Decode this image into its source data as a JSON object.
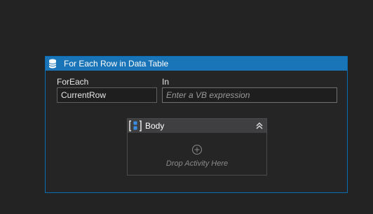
{
  "activity": {
    "title": "For Each Row in Data Table",
    "icon": "data-table-icon"
  },
  "fields": {
    "foreach_label": "ForEach",
    "foreach_value": "CurrentRow",
    "in_label": "In",
    "in_placeholder": "Enter a VB expression"
  },
  "body": {
    "title": "Body",
    "icon": "sequence-body-icon",
    "collapse_icon": "double-chevron-up-icon",
    "add_icon": "circle-plus-icon",
    "drop_hint": "Drop Activity Here"
  },
  "colors": {
    "background": "#232324",
    "header_accent": "#1a74b8",
    "border_accent": "#0a6db4",
    "body_header": "#3f3f42"
  }
}
